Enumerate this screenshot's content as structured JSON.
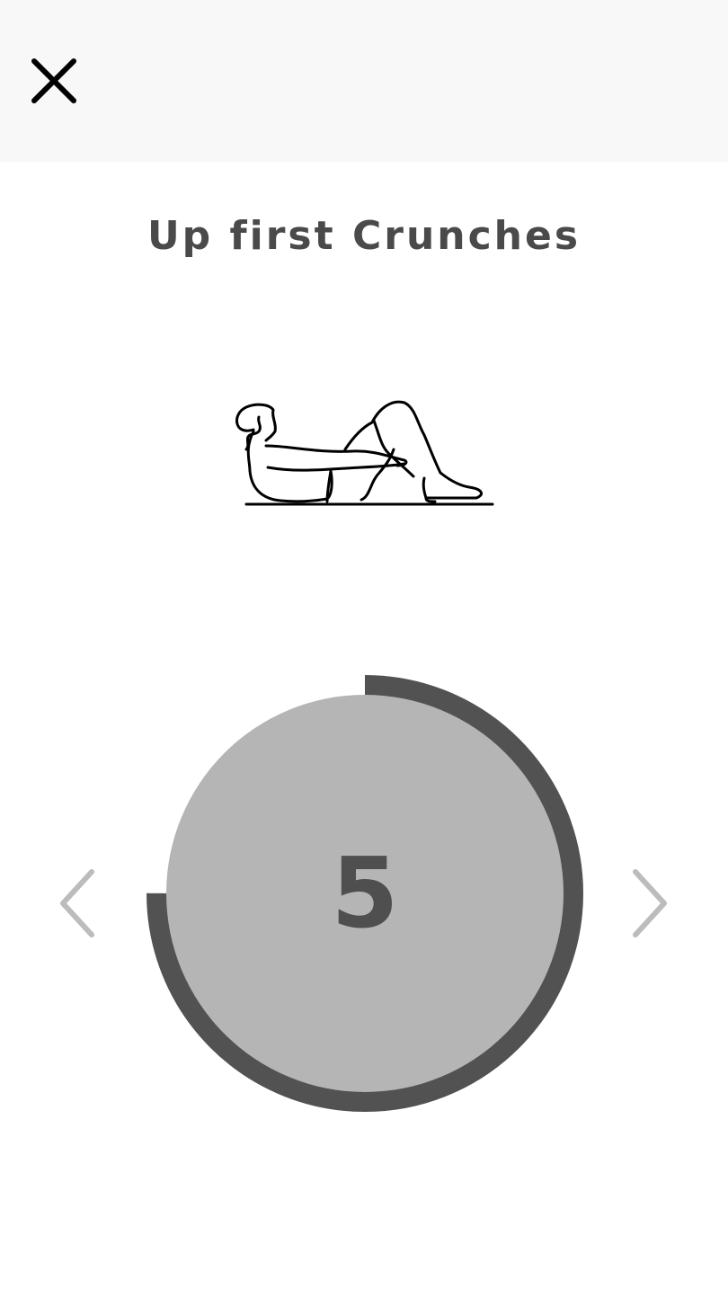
{
  "header": {
    "close_icon": "close-icon"
  },
  "exercise": {
    "title": "Up first Crunches",
    "illustration": "crunches-illustration"
  },
  "timer": {
    "count": "5",
    "progress": 0.75
  },
  "navigation": {
    "prev_icon": "chevron-left-icon",
    "next_icon": "chevron-right-icon"
  },
  "colors": {
    "topbar": "#f8f8f8",
    "title_text": "#4a4a4a",
    "timer_fill": "#b5b5b5",
    "timer_ring": "#525252",
    "chevrons": "#bcbcbc",
    "close_icon": "#000000"
  }
}
